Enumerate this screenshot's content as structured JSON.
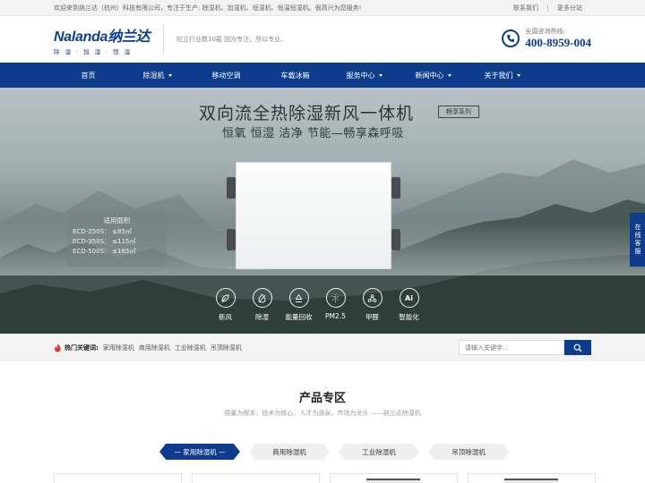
{
  "topbar": {
    "welcome": "欢迎来到纳兰达（杭州）科技有限公司，专注于生产: 除湿机、加湿机、恒湿机、恒温恒湿机。很高兴为您服务!",
    "contact": "联系我们",
    "branches": "更多分站"
  },
  "header": {
    "logo_text": "Nalanda纳兰达",
    "logo_sub": "除湿·加湿·恒湿",
    "slogan": "屹立行业数10载  因为专注，所以专业。",
    "hotline_label": "全国咨询热线:",
    "hotline_number": "400-8959-004"
  },
  "nav": {
    "items": [
      {
        "label": "首页"
      },
      {
        "label": "除湿机"
      },
      {
        "label": "移动空调"
      },
      {
        "label": "车载冰箱"
      },
      {
        "label": "服务中心"
      },
      {
        "label": "新闻中心"
      },
      {
        "label": "关于我们"
      }
    ]
  },
  "banner": {
    "title": "双向流全热除湿新风一体机",
    "tag": "畅享系列",
    "subtitle": "恒氧 恒湿 洁净 节能—畅享森呼吸",
    "spec_title": "适用面积",
    "specs": [
      "ECD-250S：  ≤85㎡",
      "ECD-350S：  ≤115㎡",
      "ECD-500S：  ≤165㎡"
    ],
    "features": [
      {
        "label": "新风",
        "icon": "leaf-icon"
      },
      {
        "label": "除湿",
        "icon": "drop-icon"
      },
      {
        "label": "能量回收",
        "icon": "recycle-icon"
      },
      {
        "label": "PM2.5",
        "icon": "particles-icon"
      },
      {
        "label": "甲醛",
        "icon": "molecule-icon"
      },
      {
        "label": "智能化",
        "icon": "ai-icon"
      }
    ],
    "ai_glyph": "Ai"
  },
  "side_service": "在线客服",
  "keywords": {
    "title": "热门关键词:",
    "links": [
      "家用除湿机",
      "商用除湿机",
      "工业除湿机",
      "吊顶除湿机"
    ]
  },
  "search": {
    "placeholder": "请输入关键字..."
  },
  "products": {
    "title": "产品专区",
    "subtitle": "质量为根本，技术为核心，人才为源泉，市场为龙头 ——纳兰达除湿机",
    "tabs": [
      "— 家用除湿机 —",
      "商用除湿机",
      "工业除湿机",
      "吊顶除湿机"
    ]
  },
  "colors": {
    "brand": "#0e3c8c",
    "accent_fire": "#e2332b"
  }
}
